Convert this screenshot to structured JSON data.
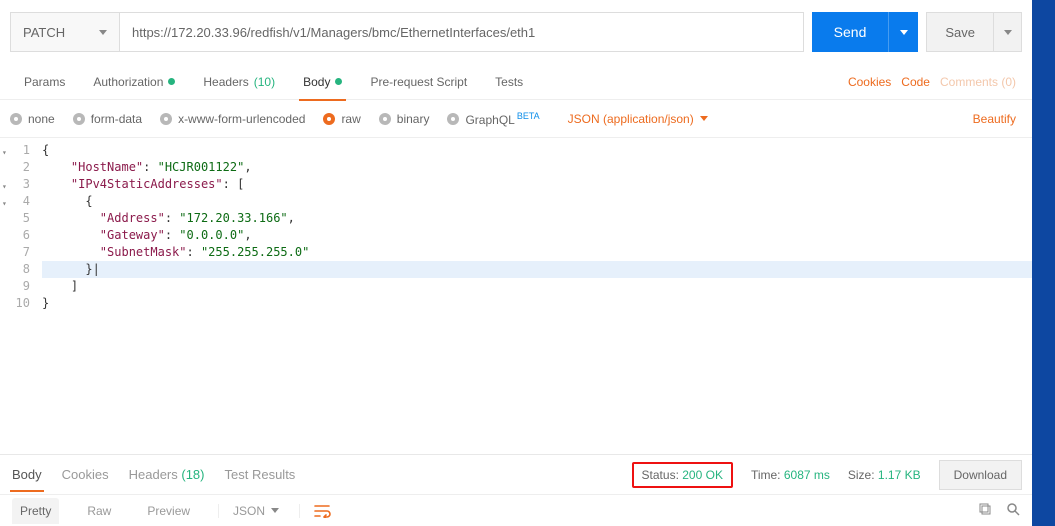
{
  "request": {
    "method": "PATCH",
    "url": "https://172.20.33.96/redfish/v1/Managers/bmc/EthernetInterfaces/eth1",
    "send_label": "Send",
    "save_label": "Save"
  },
  "req_tabs": {
    "params": "Params",
    "authorization": "Authorization",
    "headers": "Headers",
    "headers_count": "(10)",
    "body": "Body",
    "prerequest": "Pre-request Script",
    "tests": "Tests",
    "cookies": "Cookies",
    "code": "Code",
    "comments": "Comments (0)"
  },
  "body_types": {
    "none": "none",
    "formdata": "form-data",
    "urlencoded": "x-www-form-urlencoded",
    "raw": "raw",
    "binary": "binary",
    "graphql": "GraphQL",
    "beta": "BETA",
    "json_select": "JSON (application/json)",
    "beautify": "Beautify"
  },
  "code_lines": [
    {
      "n": "1",
      "fold": true,
      "segs": [
        [
          "pn",
          "{"
        ]
      ]
    },
    {
      "n": "2",
      "segs": [
        [
          "pn",
          "    "
        ],
        [
          "key",
          "\"HostName\""
        ],
        [
          "pn",
          ": "
        ],
        [
          "str",
          "\"HCJR001122\""
        ],
        [
          "pn",
          ","
        ]
      ]
    },
    {
      "n": "3",
      "fold": true,
      "segs": [
        [
          "pn",
          "    "
        ],
        [
          "key",
          "\"IPv4StaticAddresses\""
        ],
        [
          "pn",
          ": ["
        ]
      ]
    },
    {
      "n": "4",
      "fold": true,
      "segs": [
        [
          "pn",
          "      {"
        ]
      ]
    },
    {
      "n": "5",
      "segs": [
        [
          "pn",
          "        "
        ],
        [
          "key",
          "\"Address\""
        ],
        [
          "pn",
          ": "
        ],
        [
          "str",
          "\"172.20.33.166\""
        ],
        [
          "pn",
          ","
        ]
      ]
    },
    {
      "n": "6",
      "segs": [
        [
          "pn",
          "        "
        ],
        [
          "key",
          "\"Gateway\""
        ],
        [
          "pn",
          ": "
        ],
        [
          "str",
          "\"0.0.0.0\""
        ],
        [
          "pn",
          ","
        ]
      ]
    },
    {
      "n": "7",
      "segs": [
        [
          "pn",
          "        "
        ],
        [
          "key",
          "\"SubnetMask\""
        ],
        [
          "pn",
          ": "
        ],
        [
          "str",
          "\"255.255.255.0\""
        ]
      ]
    },
    {
      "n": "8",
      "hl": true,
      "segs": [
        [
          "pn",
          "      }|"
        ]
      ]
    },
    {
      "n": "9",
      "segs": [
        [
          "pn",
          "    ]"
        ]
      ]
    },
    {
      "n": "10",
      "segs": [
        [
          "pn",
          "}"
        ]
      ]
    }
  ],
  "resp_tabs": {
    "body": "Body",
    "cookies": "Cookies",
    "headers": "Headers",
    "headers_count": "(18)",
    "test_results": "Test Results"
  },
  "resp_meta": {
    "status_label": "Status:",
    "status_value": "200 OK",
    "time_label": "Time:",
    "time_value": "6087 ms",
    "size_label": "Size:",
    "size_value": "1.17 KB",
    "download": "Download"
  },
  "fmt": {
    "pretty": "Pretty",
    "raw": "Raw",
    "preview": "Preview",
    "json": "JSON"
  }
}
